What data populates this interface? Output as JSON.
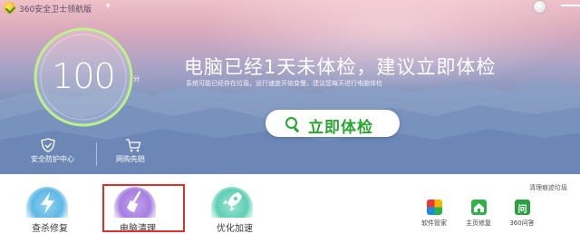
{
  "window": {
    "title": "360安全卫士领航版",
    "menu_glyph": "▾"
  },
  "hero": {
    "score": "100",
    "score_unit": "分",
    "headline": "电脑已经1天未体检，建议立即体检",
    "subline": "系统可能已经存在垃圾，运行速度开始变慢，建议您每天进行电脑体检",
    "scan_button": "立即体检",
    "shortcuts": [
      {
        "label": "安全防护中心",
        "icon": "shield-icon"
      },
      {
        "label": "网购先赔",
        "icon": "shopping-cart-icon"
      }
    ]
  },
  "tools": [
    {
      "label": "查杀修复",
      "icon": "lightning-icon",
      "color": "#5fb8e6"
    },
    {
      "label": "电脑清理",
      "icon": "broom-icon",
      "color": "#a57fe0",
      "highlighted": true
    },
    {
      "label": "优化加速",
      "icon": "rocket-icon",
      "color": "#5fcfb5"
    }
  ],
  "side_tools": {
    "more_label": "清理痕迹垃圾",
    "items": [
      {
        "label": "软件管家",
        "icon": "software-manager-icon"
      },
      {
        "label": "主页修复",
        "icon": "homepage-repair-icon"
      },
      {
        "label": "360问答",
        "icon": "question-answer-icon",
        "glyph": "问"
      }
    ]
  },
  "colors": {
    "accent_green": "#2aa531",
    "highlight_red": "#e0302a"
  }
}
